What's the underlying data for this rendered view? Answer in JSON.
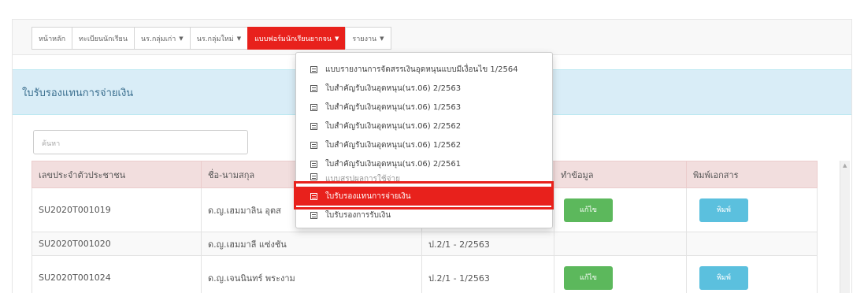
{
  "nav": {
    "items": [
      {
        "label": "หน้าหลัก",
        "caret": false,
        "active": false
      },
      {
        "label": "ทะเบียนนักเรียน",
        "caret": false,
        "active": false
      },
      {
        "label": "นร.กลุ่มเก่า",
        "caret": true,
        "active": false
      },
      {
        "label": "นร.กลุ่มใหม่",
        "caret": true,
        "active": false
      },
      {
        "label": "แบบฟอร์มนักเรียนยากจน",
        "caret": true,
        "active": true
      },
      {
        "label": "รายงาน",
        "caret": true,
        "active": false
      }
    ]
  },
  "panel": {
    "title": "ใบรับรองแทนการจ่ายเงิน"
  },
  "search": {
    "placeholder": "ค้นหา"
  },
  "table": {
    "headers": [
      "เลขประจำตัวประชาชน",
      "ชื่อ-นามสกุล",
      "",
      "ทำข้อมูล",
      "พิมพ์เอกสาร"
    ],
    "rows": [
      {
        "id": "SU2020T001019",
        "name": "ด.ญ.เฮมมาลิน อุตส",
        "level": "",
        "edit": "แก้ไข",
        "print": "พิมพ์"
      },
      {
        "id": "SU2020T001020",
        "name": "ด.ญ.เฮมมาลี แซ่งชัน",
        "level": "ป.2/1 - 2/2563",
        "edit": "",
        "print": ""
      },
      {
        "id": "SU2020T001024",
        "name": "ด.ญ.เจนนินทร์ พระงาม",
        "level": "ป.2/1 - 1/2563",
        "edit": "แก้ไข",
        "print": "พิมพ์"
      }
    ]
  },
  "dropdown": {
    "items": [
      {
        "label": "แบบรายงานการจัดสรรเงินอุดหนุนแบบมีเงื่อนไข 1/2564",
        "state": "normal"
      },
      {
        "label": "ใบสำคัญรับเงินอุดหนุน(นร.06) 2/2563",
        "state": "normal"
      },
      {
        "label": "ใบสำคัญรับเงินอุดหนุน(นร.06) 1/2563",
        "state": "normal"
      },
      {
        "label": "ใบสำคัญรับเงินอุดหนุน(นร.06) 2/2562",
        "state": "normal"
      },
      {
        "label": "ใบสำคัญรับเงินอุดหนุน(นร.06) 1/2562",
        "state": "normal"
      },
      {
        "label": "ใบสำคัญรับเงินอุดหนุน(นร.06) 2/2561",
        "state": "normal"
      },
      {
        "label": "แบบสรุปผลการใช้จ่าย",
        "state": "faded"
      },
      {
        "label": "ใบรับรองแทนการจ่ายเงิน",
        "state": "active"
      },
      {
        "label": "ใบรับรองการรับเงิน",
        "state": "normal"
      }
    ]
  },
  "colors": {
    "accent": "#e8211c",
    "panel_bg": "#d9edf7",
    "header_bg": "#f2dede",
    "edit_btn": "#5cb85c",
    "print_btn": "#5bc0de"
  }
}
